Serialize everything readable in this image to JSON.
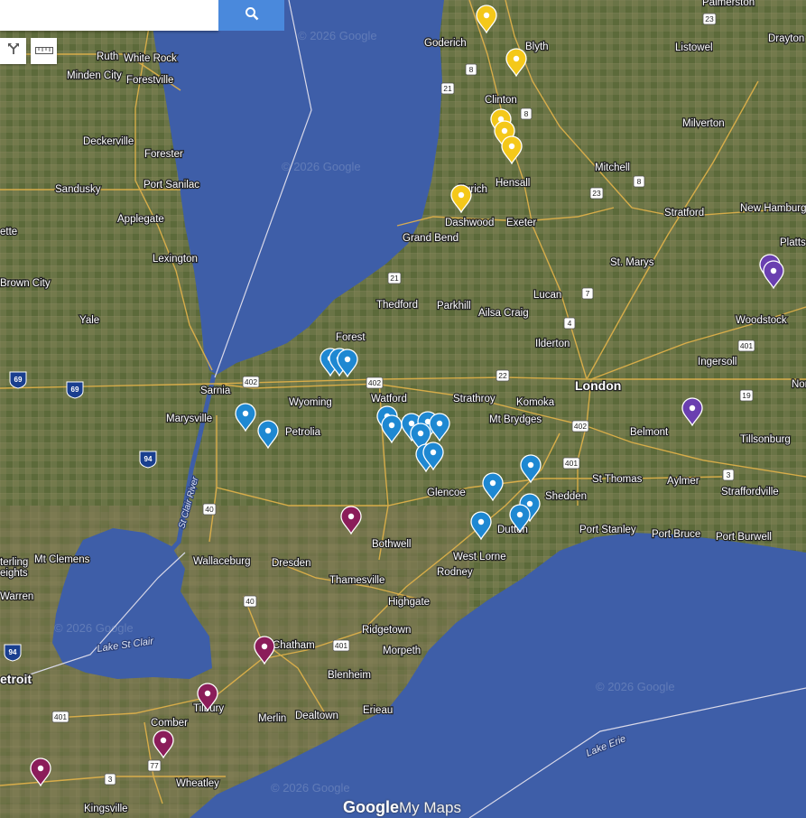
{
  "search": {
    "placeholder": "",
    "value": ""
  },
  "toolbar": {
    "tools": [
      "directions-icon",
      "ruler-icon"
    ]
  },
  "logo": {
    "brand": "Google",
    "product": "My Maps"
  },
  "watermark": "© 2026 Google",
  "colors": {
    "yellow": "#f4c81a",
    "blue": "#1e88d2",
    "maroon": "#8b1d5a",
    "purple": "#6a3fb0",
    "water": "#3e5ea8"
  },
  "labels": {
    "cities": [
      {
        "id": "goderich",
        "text": "Goderich"
      },
      {
        "id": "blyth",
        "text": "Blyth"
      },
      {
        "id": "listowel",
        "text": "Listowel"
      },
      {
        "id": "palmerston",
        "text": "Palmerston"
      },
      {
        "id": "drayton",
        "text": "Drayton"
      },
      {
        "id": "clinton",
        "text": "Clinton"
      },
      {
        "id": "milverton",
        "text": "Milverton"
      },
      {
        "id": "mitchell",
        "text": "Mitchell"
      },
      {
        "id": "hensall",
        "text": "Hensall"
      },
      {
        "id": "zurich",
        "text": "Zurich"
      },
      {
        "id": "dashwood",
        "text": "Dashwood"
      },
      {
        "id": "exeter",
        "text": "Exeter"
      },
      {
        "id": "stratford",
        "text": "Stratford"
      },
      {
        "id": "new-hamburg",
        "text": "New Hamburg"
      },
      {
        "id": "grand-bend",
        "text": "Grand Bend"
      },
      {
        "id": "st-marys",
        "text": "St. Marys"
      },
      {
        "id": "platts",
        "text": "Platts"
      },
      {
        "id": "thedford",
        "text": "Thedford"
      },
      {
        "id": "parkhill",
        "text": "Parkhill"
      },
      {
        "id": "ailsa-craig",
        "text": "Ailsa Craig"
      },
      {
        "id": "lucan",
        "text": "Lucan"
      },
      {
        "id": "woodstock",
        "text": "Woodstock"
      },
      {
        "id": "forest",
        "text": "Forest"
      },
      {
        "id": "ilderton",
        "text": "Ilderton"
      },
      {
        "id": "ingersoll",
        "text": "Ingersoll"
      },
      {
        "id": "sarnia",
        "text": "Sarnia"
      },
      {
        "id": "wyoming",
        "text": "Wyoming"
      },
      {
        "id": "watford",
        "text": "Watford"
      },
      {
        "id": "strathroy",
        "text": "Strathroy"
      },
      {
        "id": "komoka",
        "text": "Komoka"
      },
      {
        "id": "london",
        "text": "London"
      },
      {
        "id": "marysville",
        "text": "Marysville"
      },
      {
        "id": "petrolia",
        "text": "Petrolia"
      },
      {
        "id": "mt-brydges",
        "text": "Mt Brydges"
      },
      {
        "id": "belmont",
        "text": "Belmont"
      },
      {
        "id": "tillsonburg",
        "text": "Tillsonburg"
      },
      {
        "id": "nor",
        "text": "Nor"
      },
      {
        "id": "st-thomas",
        "text": "St Thomas"
      },
      {
        "id": "aylmer",
        "text": "Aylmer"
      },
      {
        "id": "straffordville",
        "text": "Straffordville"
      },
      {
        "id": "glencoe",
        "text": "Glencoe"
      },
      {
        "id": "shedden",
        "text": "Shedden"
      },
      {
        "id": "port-stanley",
        "text": "Port Stanley"
      },
      {
        "id": "port-bruce",
        "text": "Port Bruce"
      },
      {
        "id": "port-burwell",
        "text": "Port Burwell"
      },
      {
        "id": "bothwell",
        "text": "Bothwell"
      },
      {
        "id": "dutton",
        "text": "Dutton"
      },
      {
        "id": "west-lorne",
        "text": "West Lorne"
      },
      {
        "id": "rodney",
        "text": "Rodney"
      },
      {
        "id": "wallaceburg",
        "text": "Wallaceburg"
      },
      {
        "id": "dresden",
        "text": "Dresden"
      },
      {
        "id": "thamesville",
        "text": "Thamesville"
      },
      {
        "id": "highgate",
        "text": "Highgate"
      },
      {
        "id": "chatham",
        "text": "Chatham"
      },
      {
        "id": "ridgetown",
        "text": "Ridgetown"
      },
      {
        "id": "morpeth",
        "text": "Morpeth"
      },
      {
        "id": "blenheim",
        "text": "Blenheim"
      },
      {
        "id": "tilbury",
        "text": "Tilbury"
      },
      {
        "id": "merlin",
        "text": "Merlin"
      },
      {
        "id": "dealtown",
        "text": "Dealtown"
      },
      {
        "id": "erieau",
        "text": "Erieau"
      },
      {
        "id": "comber",
        "text": "Comber"
      },
      {
        "id": "wheatley",
        "text": "Wheatley"
      },
      {
        "id": "kingsville",
        "text": "Kingsville"
      },
      {
        "id": "detroit",
        "text": "etroit"
      },
      {
        "id": "mt-clemens",
        "text": "Mt Clemens"
      },
      {
        "id": "sterling",
        "text": "terling"
      },
      {
        "id": "heights",
        "text": "eights"
      },
      {
        "id": "warren",
        "text": "Warren"
      },
      {
        "id": "ruth",
        "text": "Ruth"
      },
      {
        "id": "white-rock",
        "text": "White Rock"
      },
      {
        "id": "minden-city",
        "text": "Minden City"
      },
      {
        "id": "forestville",
        "text": "Forestville"
      },
      {
        "id": "deckerville",
        "text": "Deckerville"
      },
      {
        "id": "forester",
        "text": "Forester"
      },
      {
        "id": "sandusky",
        "text": "Sandusky"
      },
      {
        "id": "port-sanilac",
        "text": "Port Sanilac"
      },
      {
        "id": "applegate",
        "text": "Applegate"
      },
      {
        "id": "ette",
        "text": "ette"
      },
      {
        "id": "lexington",
        "text": "Lexington"
      },
      {
        "id": "brown-city",
        "text": "Brown City"
      },
      {
        "id": "yale",
        "text": "Yale"
      }
    ],
    "water": [
      {
        "id": "lake-st-clair",
        "text": "Lake St Clair"
      },
      {
        "id": "lake-erie",
        "text": "Lake Erie"
      }
    ],
    "river": "St Clair River",
    "routes": {
      "r23": "23",
      "r8a": "8",
      "r21a": "21",
      "r8b": "8",
      "r8c": "8",
      "r23b": "23",
      "r21b": "21",
      "r7": "7",
      "r4": "4",
      "r402a": "402",
      "r402b": "402",
      "r22": "22",
      "r401a": "401",
      "r19": "19",
      "r402c": "402",
      "r401b": "401",
      "r3a": "3",
      "r40a": "40",
      "r40b": "40",
      "r401c": "401",
      "r401d": "401",
      "r77": "77",
      "r3b": "3"
    },
    "interstates": {
      "i69a": "69",
      "i69b": "69",
      "i94a": "94",
      "i94b": "94"
    }
  }
}
